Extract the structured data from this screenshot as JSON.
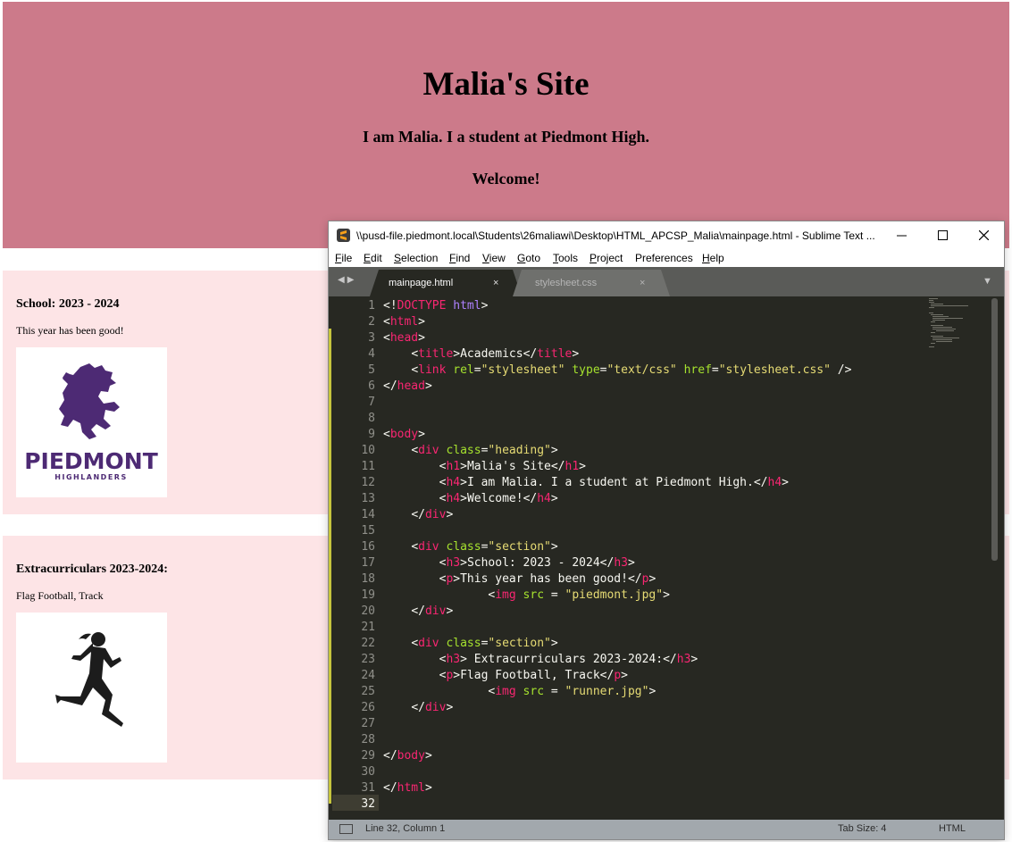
{
  "webpage": {
    "heading": {
      "h1": "Malia's Site",
      "h4_1": "I am Malia. I a student at Piedmont High.",
      "h4_2": "Welcome!"
    },
    "section1": {
      "h3": "School: 2023 - 2024",
      "p": "This year has been good!",
      "logo_top": "",
      "logo_text": "PIEDMONT",
      "logo_sub": "HIGHLANDERS"
    },
    "section2": {
      "h3": "Extracurriculars 2023-2024:",
      "p": "Flag Football, Track"
    },
    "colors": {
      "heading_bg": "#cc7a8a",
      "section_bg": "#fde4e6",
      "logo_purple": "#4d2a74"
    }
  },
  "editor": {
    "title": "\\\\pusd-file.piedmont.local\\Students\\26maliawi\\Desktop\\HTML_APCSP_Malia\\mainpage.html - Sublime Text ...",
    "menu": [
      {
        "u": "F",
        "rest": "ile"
      },
      {
        "u": "E",
        "rest": "dit"
      },
      {
        "u": "S",
        "rest": "election"
      },
      {
        "u": "F",
        "rest": "ind"
      },
      {
        "u": "V",
        "rest": "iew"
      },
      {
        "u": "G",
        "rest": "oto"
      },
      {
        "u": "T",
        "rest": "ools"
      },
      {
        "u": "P",
        "rest": "roject"
      },
      {
        "u": "",
        "rest": "Preferences"
      },
      {
        "u": "H",
        "rest": "elp"
      }
    ],
    "tabs": [
      {
        "label": "mainpage.html",
        "active": true,
        "close": "×"
      },
      {
        "label": "stylesheet.css",
        "active": false,
        "close": "×"
      }
    ],
    "line_numbers": [
      "1",
      "2",
      "3",
      "4",
      "5",
      "6",
      "7",
      "8",
      "9",
      "10",
      "11",
      "12",
      "13",
      "14",
      "15",
      "16",
      "17",
      "18",
      "19",
      "20",
      "21",
      "22",
      "23",
      "24",
      "25",
      "26",
      "27",
      "28",
      "29",
      "30",
      "31",
      "32"
    ],
    "code_lines": [
      "<!DOCTYPE html>",
      "<html>",
      "<head>",
      "    <title>Academics</title>",
      "    <link rel=\"stylesheet\" type=\"text/css\" href=\"stylesheet.css\" />",
      "</head>",
      "",
      "",
      "<body>",
      "    <div class=\"heading\">",
      "        <h1>Malia's Site</h1>",
      "        <h4>I am Malia. I a student at Piedmont High.</h4>",
      "        <h4>Welcome!</h4>",
      "    </div>",
      "",
      "    <div class=\"section\">",
      "        <h3>School: 2023 - 2024</h3>",
      "        <p>This year has been good!</p>",
      "               <img src = \"piedmont.jpg\">",
      "    </div>",
      "",
      "    <div class=\"section\">",
      "        <h3> Extracurriculars 2023-2024:</h3>",
      "        <p>Flag Football, Track</p>",
      "               <img src = \"runner.jpg\">",
      "    </div>",
      "",
      "",
      "</body>",
      "",
      "</html>",
      ""
    ],
    "status": {
      "position": "Line 32, Column 1",
      "tab_size": "Tab Size: 4",
      "syntax": "HTML"
    },
    "colors": {
      "bg": "#272822",
      "tag": "#f92672",
      "attr": "#a6e22e",
      "string": "#e6db74",
      "doctype": "#ae81ff"
    }
  }
}
